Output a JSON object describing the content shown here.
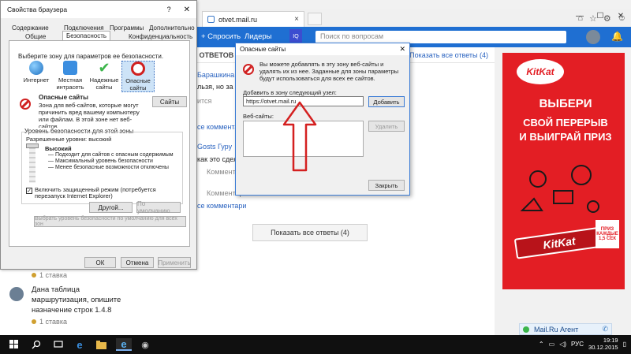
{
  "browser": {
    "tab_title": "otvet.mail.ru",
    "window_controls": [
      "—",
      "☐",
      "✕"
    ],
    "tools": [
      "⌂",
      "☆",
      "⚙",
      "☺"
    ]
  },
  "site": {
    "ask_label": "+ Спросить",
    "leaders_label": "Лидеры",
    "badge_label": "IQ",
    "search_placeholder": "Поиск по вопросам"
  },
  "main": {
    "answers_label": "3 ОТВЕТОВ",
    "show_all_top": "Показать все ответы (4)",
    "frag_author1": "Барашкина",
    "frag_text1": "льзя, но за",
    "frag_complain1": "ится",
    "frag_comment1": "се комментари",
    "frag_author2": "Gosts Гуру",
    "frag_text2": "как это сдел",
    "frag_comment2": "Комментар",
    "frag_comment3": "Комментари",
    "frag_comment4": "се комментари",
    "show_all_btn": "Показать все ответы (4)"
  },
  "left": {
    "stavka1": "1 ставка",
    "question": "Дана таблица маршрутизация, опишите назначение строк 1.4.8",
    "stavka2": "1 ставка"
  },
  "ad": {
    "logo": "KitKat",
    "line1": "ВЫБЕРИ",
    "line2": "СВОЙ ПЕРЕРЫВ",
    "line3": "И ВЫИГРАЙ ПРИЗ",
    "bar_text": "KitKat",
    "pack_text": "ПРИЗ КАЖДЫЕ 1,5 СЕК"
  },
  "agent": {
    "label": "Mail.Ru Агент"
  },
  "internet_options": {
    "title": "Свойства браузера",
    "help": "?",
    "close": "✕",
    "tabs_row1": [
      "Содержание",
      "Подключения",
      "Программы",
      "Дополнительно"
    ],
    "tabs_row2": [
      "Общие",
      "Безопасность",
      "Конфиденциальность"
    ],
    "zone_prompt": "Выберите зону для параметров ее безопасности.",
    "zones": [
      "Интернет",
      "Местная интрасеть",
      "Надежные сайты",
      "Опасные сайты"
    ],
    "zone_name": "Опасные сайты",
    "zone_desc": "Зона для веб-сайтов, которые могут причинить вред вашему компьютеру или файлам. В этой зоне нет веб-сайтов.",
    "sites_button": "Сайты",
    "level_title": "Уровень безопасности для этой зоны",
    "allowed_levels": "Разрешенные уровни: высокий",
    "level_name": "Высокий",
    "level_points": [
      "— Подходит для сайтов с опасным содержимым",
      "— Максимальный уровень безопасности",
      "— Менее безопасные возможности отключены"
    ],
    "protected_mode": "Включить защищенный режим (потребуется перезапуск Internet Explorer)",
    "check_mark": "✓",
    "custom_button": "Другой...",
    "default_button": "По умолчанию",
    "reset_all_button": "Выбрать уровень безопасности по умолчанию для всех зон",
    "ok_button": "ОК",
    "cancel_button": "Отмена",
    "apply_button": "Применить"
  },
  "dangerous_sites": {
    "title": "Опасные сайты",
    "close": "✕",
    "info": "Вы можете добавлять в эту зону веб-сайты и удалять их из нее. Заданные для зоны параметры будут использоваться для всех ее сайтов.",
    "add_label": "Добавить в зону следующий узел:",
    "add_value": "https://otvet.mail.ru",
    "add_button": "Добавить",
    "sites_label": "Веб-сайты:",
    "remove_button": "Удалить",
    "close_button": "Закрыть"
  },
  "taskbar": {
    "language": "РУС",
    "time": "19:19",
    "date": "30.12.2015"
  },
  "colors": {
    "site_blue": "#1f6fd2",
    "ad_red": "#e31e24",
    "arrow_red": "#d42020"
  }
}
